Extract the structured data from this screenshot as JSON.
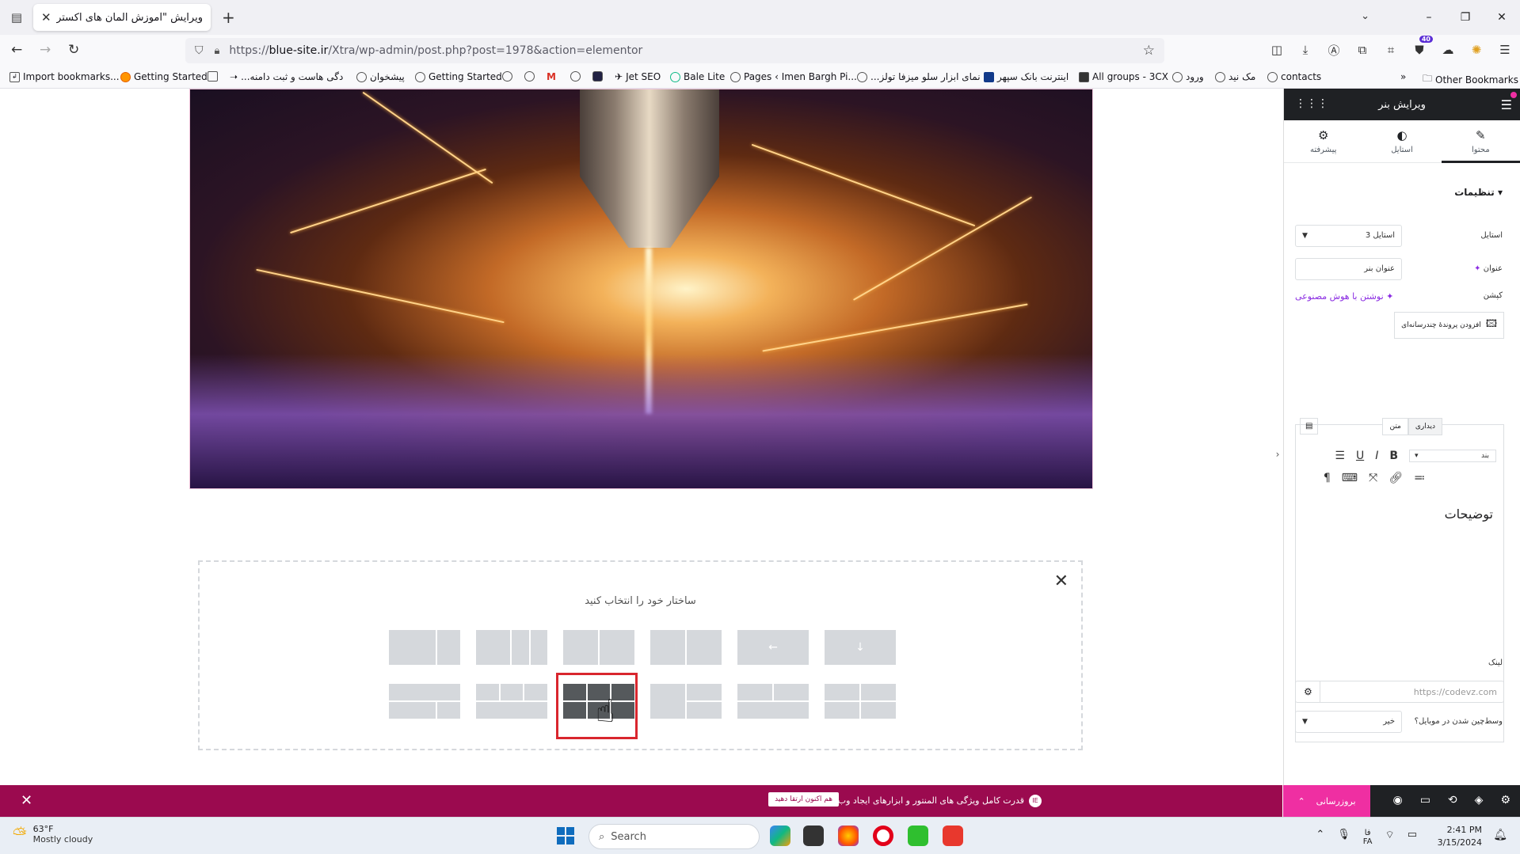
{
  "browser": {
    "tab_title": "ویرایش \"آموزش المان های اکسترا –",
    "url_prefix": "https://",
    "url_host": "blue-site.ir",
    "url_path": "/Xtra/wp-admin/post.php?post=1978&action=elementor",
    "extension_badge": "40",
    "bookmarks": [
      "Import bookmarks...",
      "Getting Started",
      "...دگی هاست و ثبت دامنه",
      "پیشخوان",
      "Getting Started",
      "Jet SEO",
      "Bale Lite",
      "Pages ‹ Imen Bargh Pi...",
      "...نمای ابزار سلو میزفا تولز",
      "اینترنت بانک سپهر",
      "All groups - 3CX",
      "ورود",
      "مک نید",
      "contacts"
    ],
    "other_bookmarks": "Other Bookmarks"
  },
  "canvas": {
    "picker_title": "ساختار خود را انتخاب کنید"
  },
  "panel": {
    "header_title": "ویرایش بنر",
    "tabs": [
      {
        "label": "محتوا",
        "icon": "pencil-icon"
      },
      {
        "label": "استایل",
        "icon": "half-circle-icon"
      },
      {
        "label": "پیشرفته",
        "icon": "gear-icon"
      }
    ],
    "section_title": "تنظیمات",
    "style_label": "استایل",
    "style_value": "استایل 3",
    "title_label": "عنوان",
    "title_value": "عنوان بنر",
    "caption_label": "کپشن",
    "ai_write": "نوشتن با هوش مصنوعی",
    "add_media": "افزودن پروندهٔ چندرسانه‌ای",
    "editor_tab_visual": "دیداری",
    "editor_tab_text": "متن",
    "paragraph_select": "بند",
    "editor_content": "توضیحات",
    "link_label": "لینک",
    "link_placeholder": "https://codevz.com",
    "mobile_label": "وسط‌چین شدن در موبایل؟",
    "mobile_value": "خیر"
  },
  "notice": {
    "message": "قدرت کامل ویژگی های المنتور و ابزارهای ایجاد وب را فعال کنید.",
    "cta": "هم اکنون ارتقا دهید",
    "logo_text": "IE"
  },
  "footer": {
    "update_label": "بروزرسانی"
  },
  "taskbar": {
    "temperature": "63°F",
    "weather": "Mostly cloudy",
    "search_placeholder": "Search",
    "lang_top": "فا",
    "lang_bottom": "FA",
    "time": "2:41 PM",
    "date": "3/15/2024"
  }
}
